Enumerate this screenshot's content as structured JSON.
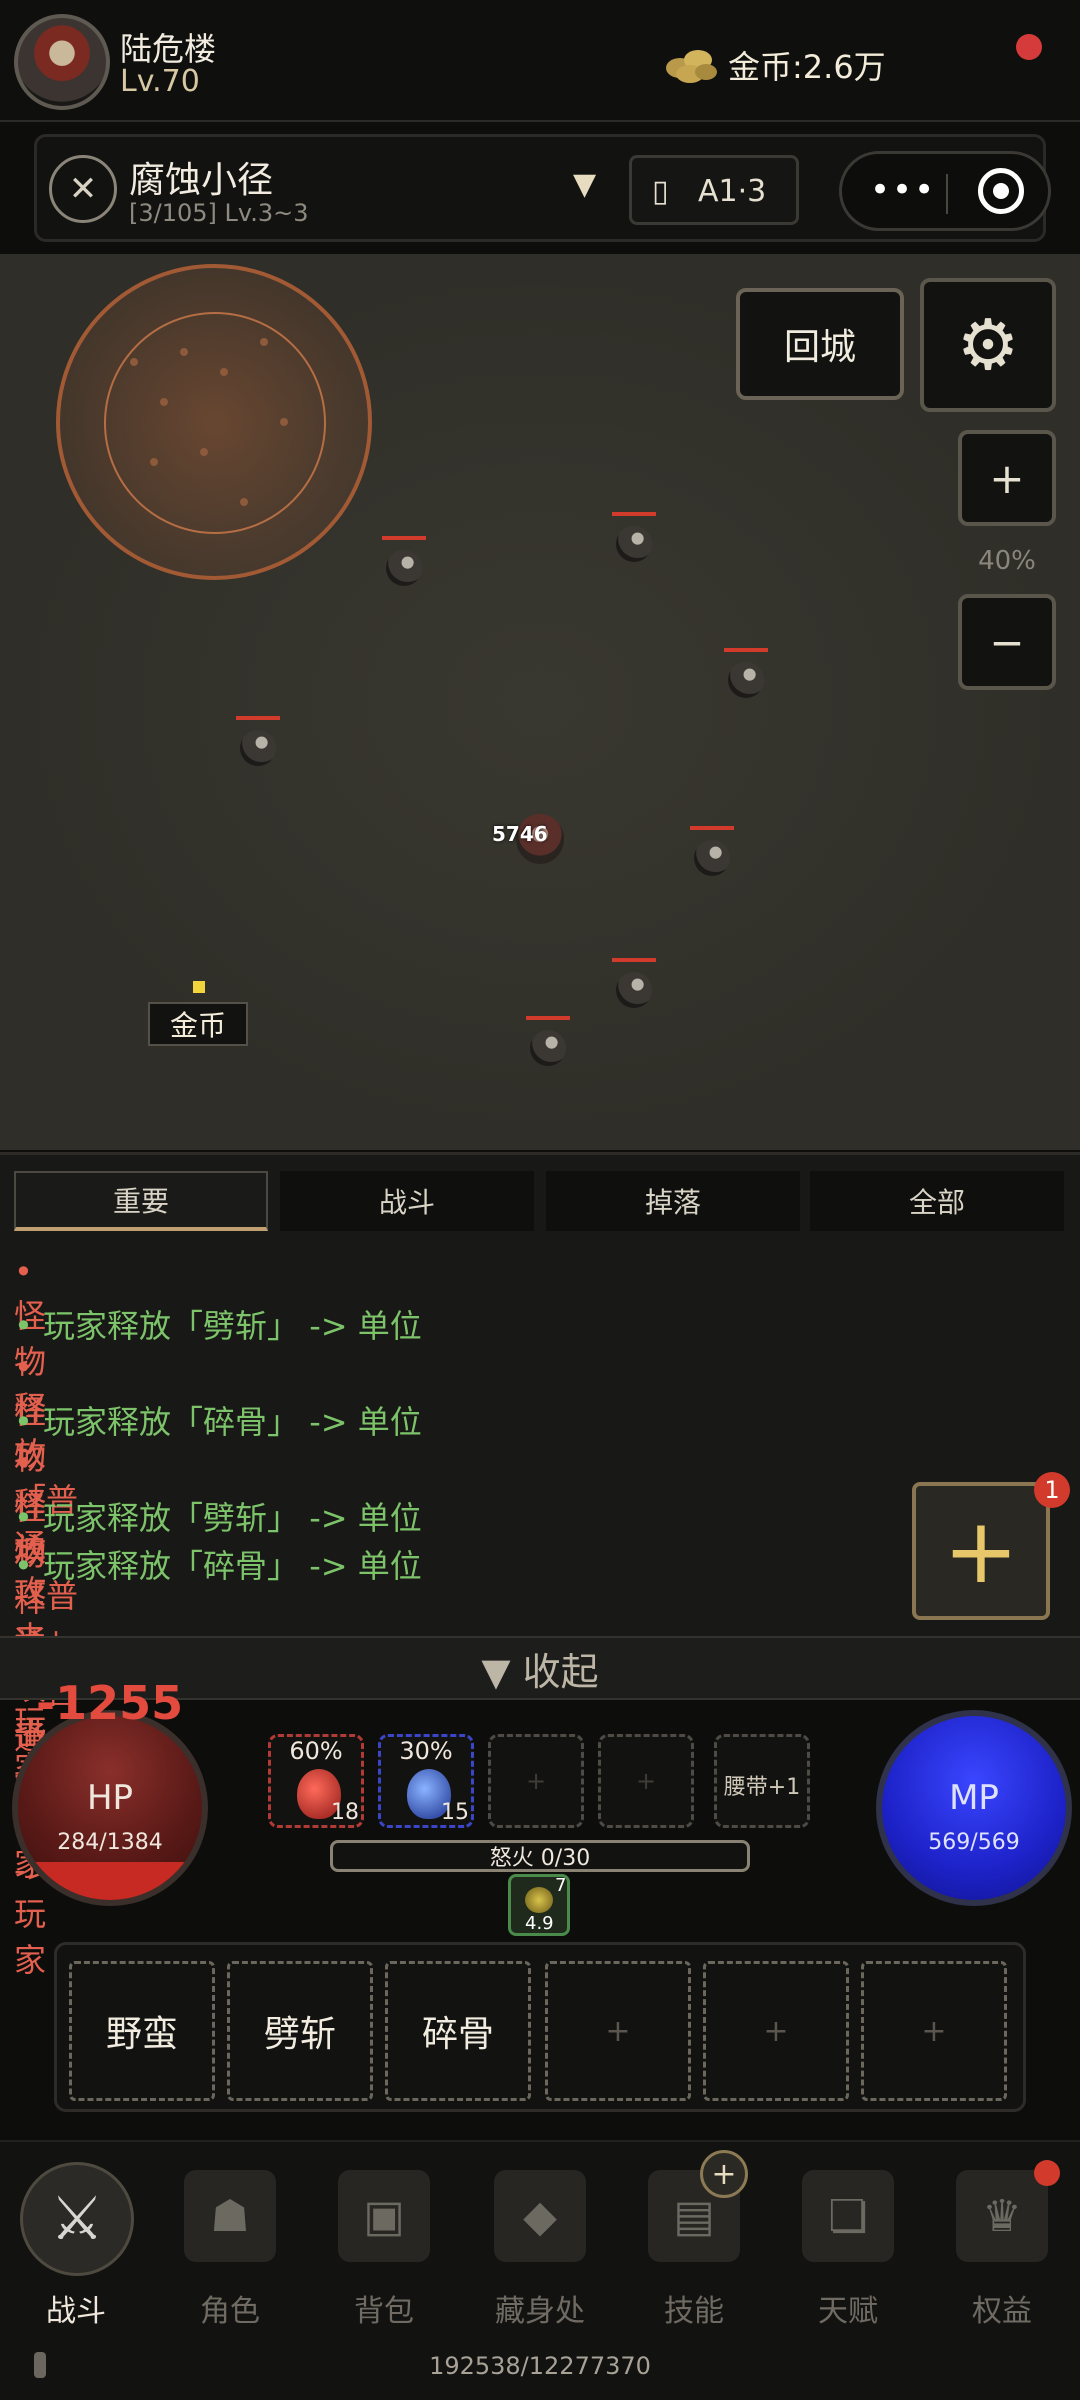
{
  "player": {
    "name": "陆危楼",
    "level": "Lv.70",
    "gold": "金币:2.6万"
  },
  "map": {
    "name": "腐蚀小径",
    "sub": "[3/105] Lv.3~3",
    "dropdown": "▼",
    "zone": "A1·3"
  },
  "field": {
    "town_label": "回城",
    "zoom_in": "+",
    "zoom_out": "−",
    "zoom_level": "40%",
    "damage_number": "5746",
    "coin_drop_label": "金币"
  },
  "log": {
    "tabs": [
      "重要",
      "战斗",
      "掉落",
      "全部"
    ],
    "active_tab": 0,
    "lines": [
      {
        "text": "• 怪物释放「普通攻击」 -> 玩家",
        "kind": "monster"
      },
      {
        "text": "• 玩家释放「劈斩」 -> 单位",
        "kind": "player"
      },
      {
        "text": "• 怪物释放「普通攻击」 -> 玩家",
        "kind": "monster"
      },
      {
        "text": "• 玩家释放「碎骨」 -> 单位",
        "kind": "player"
      },
      {
        "text": "• 怪物释放「普通攻击」 -> 玩家",
        "kind": "monster"
      },
      {
        "text": "• 玩家释放「劈斩」 -> 单位",
        "kind": "player"
      },
      {
        "text": "• 玩家释放「碎骨」 -> 单位",
        "kind": "player"
      }
    ],
    "plus_badge": "1",
    "collapse_label": "▼ 收起"
  },
  "hud": {
    "damage_taken": "-1255",
    "hp_label": "HP",
    "hp_value": "284/1384",
    "hp_fraction": 0.205,
    "mp_label": "MP",
    "mp_value": "569/569",
    "potions": [
      {
        "pct": "60%",
        "count": "18"
      },
      {
        "pct": "30%",
        "count": "15"
      }
    ],
    "belt_label": "腰带+1",
    "rage_label": "怒火 0/30",
    "buff": {
      "stack": "7",
      "time": "4.9"
    }
  },
  "skills": [
    "野蛮",
    "劈斩",
    "碎骨",
    "+",
    "+",
    "+"
  ],
  "nav": {
    "items": [
      "战斗",
      "角色",
      "背包",
      "藏身处",
      "技能",
      "天赋",
      "权益"
    ],
    "active": 0
  },
  "footer": {
    "stat": "192538/12277370"
  },
  "colors": {
    "hp": "#c62a23",
    "mp": "#1d22c8",
    "accent": "#c0a070",
    "monster_log": "#e35f4e",
    "player_log": "#7cc36a"
  }
}
